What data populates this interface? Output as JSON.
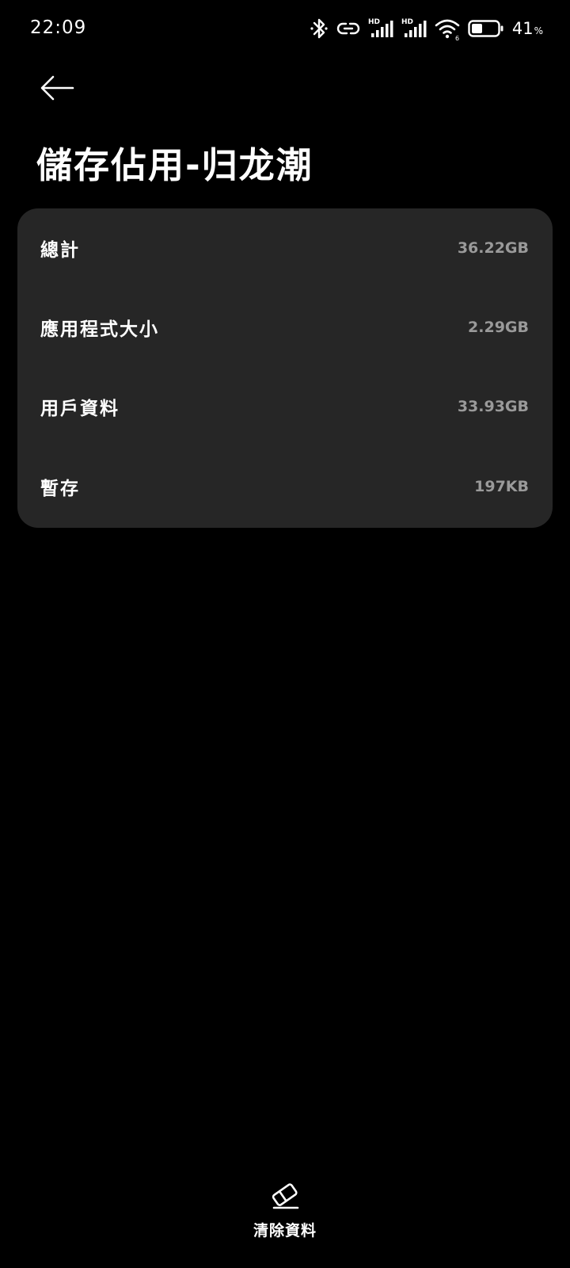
{
  "status_bar": {
    "time": "22:09",
    "battery_percent": "41",
    "battery_level": 0.41,
    "icons": [
      "bluetooth-icon",
      "link-icon",
      "signal-hd-icon",
      "signal-hd-icon",
      "wifi-icon",
      "battery-icon"
    ]
  },
  "header": {
    "back_icon": "arrow-left-icon",
    "title": "儲存佔用-归龙潮"
  },
  "storage": {
    "rows": [
      {
        "label": "總計",
        "value": "36.22GB"
      },
      {
        "label": "應用程式大小",
        "value": "2.29GB"
      },
      {
        "label": "用戶資料",
        "value": "33.93GB"
      },
      {
        "label": "暫存",
        "value": "197KB"
      }
    ]
  },
  "footer": {
    "clear_data_label": "清除資料",
    "clear_data_icon": "eraser-icon"
  },
  "colors": {
    "background": "#000000",
    "card": "#262626",
    "value_text": "#9a9a9a",
    "text": "#ffffff"
  }
}
